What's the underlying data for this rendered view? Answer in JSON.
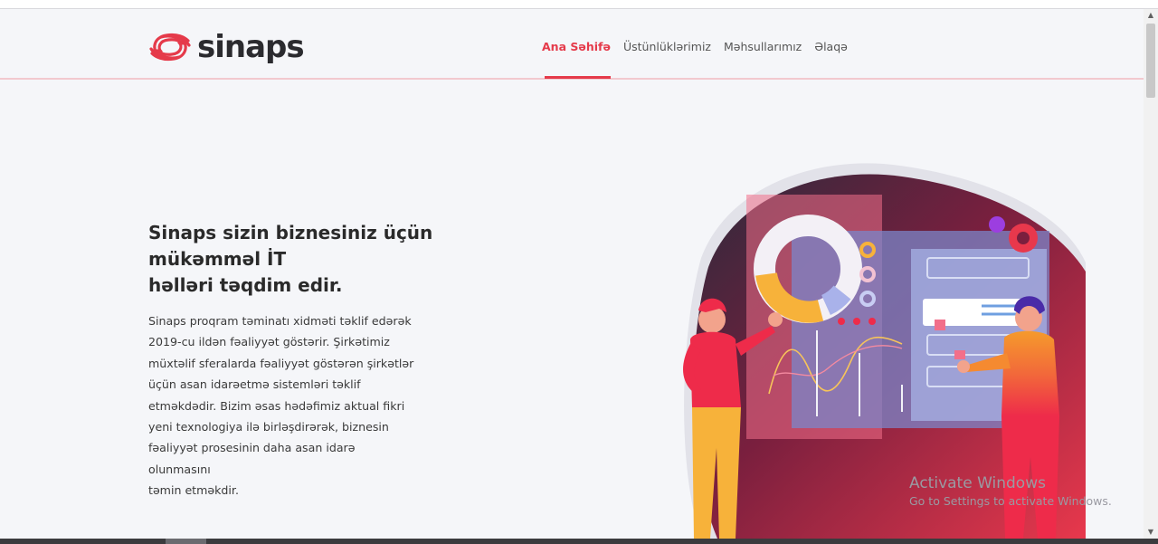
{
  "brand": {
    "name": "sinaps",
    "accent": "#e53a4a"
  },
  "nav": {
    "items": [
      {
        "label": "Ana Səhifə",
        "active": true
      },
      {
        "label": "Üstünlüklərimiz",
        "active": false
      },
      {
        "label": "Məhsullarımız",
        "active": false
      },
      {
        "label": "Əlaqə",
        "active": false
      }
    ]
  },
  "hero": {
    "title_line1": "Sinaps sizin biznesiniz üçün mükəmməl İT",
    "title_line2": "həlləri təqdim edir.",
    "paragraph_lines": [
      "Sinaps proqram təminatı xidməti təklif edərək",
      "2019-cu ildən fəaliyyət göstərir. Şirkətimiz",
      "müxtəlif sferalarda fəaliyyət göstərən şirkətlər",
      "üçün asan idarəetmə sistemləri təklif",
      "etməkdədir. Bizim əsas hədəfimiz aktual fikri",
      "yeni texnologiya ilə birləşdirərək, biznesin",
      "fəaliyyət prosesinin daha asan idarə olunmasını",
      "təmin etməkdir."
    ]
  },
  "watermark": {
    "line1": "Activate Windows",
    "line2": "Go to Settings to activate Windows."
  },
  "icons": [
    "sinaps-logo-icon",
    "dashboard-illustration"
  ]
}
